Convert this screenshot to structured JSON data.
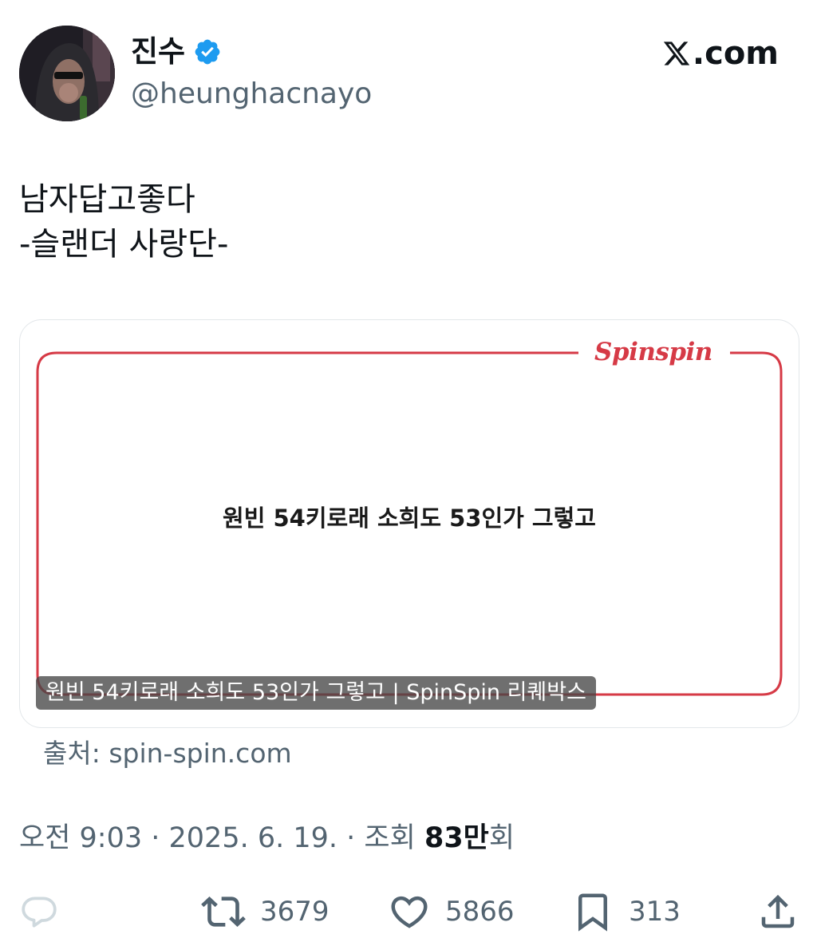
{
  "author": {
    "display_name": "진수",
    "handle": "@heunghacnayo",
    "verified": true,
    "avatar_icon": "avatar-photo"
  },
  "site": {
    "label": ".com",
    "logo_icon": "x-logo-icon"
  },
  "tweet": {
    "text": "남자답고좋다\n-슬랜더 사랑단-"
  },
  "card": {
    "brand": "Spinspin",
    "headline": "원빈 54키로래 소희도 53인가 그렇고",
    "caption": "원빈 54키로래 소희도 53인가 그렇고 | SpinSpin 리퀘박스",
    "frame_color": "#d63a46"
  },
  "source": "출처: spin-spin.com",
  "meta": {
    "time": "오전 9:03",
    "separator": " · ",
    "date": "2025. 6. 19.",
    "views_label": "조회",
    "views_count": "83만",
    "views_suffix": "회"
  },
  "actions": {
    "reply_icon": "reply-icon",
    "retweet_count": "3679",
    "like_count": "5866",
    "bookmark_count": "313",
    "share_icon": "share-icon"
  },
  "colors": {
    "text_primary": "#0f1419",
    "text_secondary": "#536471",
    "verified_blue": "#1d9bf0",
    "action_icon": "#536471"
  }
}
